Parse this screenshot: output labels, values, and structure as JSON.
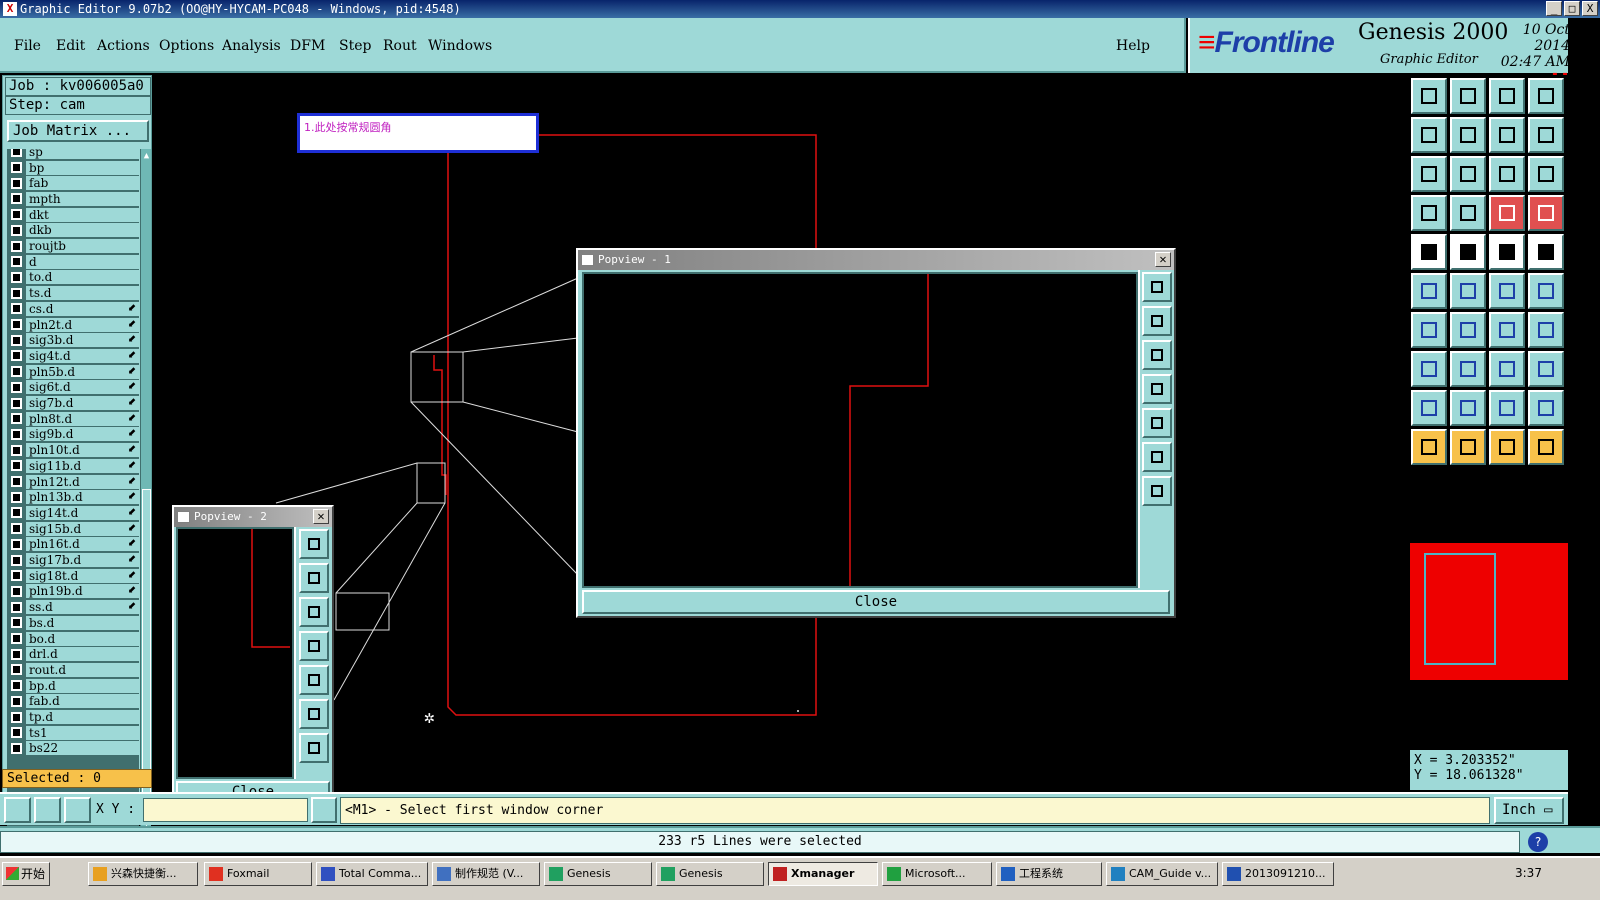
{
  "window": {
    "title": "Graphic Editor 9.07b2 (OO@HY-HYCAM-PC048 - Windows, pid:4548)",
    "controls": [
      "_",
      "□",
      "X"
    ]
  },
  "menu": {
    "items": [
      "File",
      "Edit",
      "Actions",
      "Options",
      "Analysis",
      "DFM",
      "Step",
      "Rout",
      "Windows"
    ],
    "help": "Help"
  },
  "brand": {
    "logo": "Frontline",
    "product": "Genesis 2000",
    "subtitle": "Graphic Editor",
    "date": "10 Oct 2014",
    "time": "02:47 AM"
  },
  "job": {
    "job_label": "Job : kv006005a0",
    "step_label": "Step: cam",
    "matrix_button": "Job Matrix ..."
  },
  "layers": [
    "sp",
    "bp",
    "fab",
    "mpth",
    "dkt",
    "dkb",
    "roujtb",
    "d",
    "to.d",
    "ts.d",
    "cs.d",
    "pln2t.d",
    "sig3b.d",
    "sig4t.d",
    "pln5b.d",
    "sig6t.d",
    "sig7b.d",
    "pln8t.d",
    "sig9b.d",
    "pln10t.d",
    "sig11b.d",
    "pln12t.d",
    "pln13b.d",
    "sig14t.d",
    "sig15b.d",
    "pln16t.d",
    "sig17b.d",
    "sig18t.d",
    "pln19b.d",
    "ss.d",
    "bs.d",
    "bo.d",
    "drl.d",
    "rout.d",
    "bp.d",
    "fab.d",
    "tp.d",
    "ts1",
    "bs22"
  ],
  "layer_flags": [
    "cs.d",
    "pln2t.d",
    "sig3b.d",
    "sig4t.d",
    "pln5b.d",
    "sig6t.d",
    "sig7b.d",
    "pln8t.d",
    "sig9b.d",
    "pln10t.d",
    "sig11b.d",
    "pln12t.d",
    "pln13b.d",
    "sig14t.d",
    "sig15b.d",
    "pln16t.d",
    "sig17b.d",
    "sig18t.d",
    "pln19b.d",
    "ss.d"
  ],
  "selected": "Selected : 0",
  "note": {
    "text": "1.此处按常规圆角"
  },
  "popview1": {
    "title": "Popview - 1",
    "close": "Close"
  },
  "popview2": {
    "title": "Popview - 2",
    "close": "Close"
  },
  "coords": {
    "x": "X = 3.203352\"",
    "y": "Y = 18.061328\""
  },
  "bottombar": {
    "xy_label": "X Y :",
    "message": "<M1> - Select first window corner",
    "unit": "Inch"
  },
  "status": {
    "text": "233 r5 Lines were selected"
  },
  "taskbar": {
    "start": "开始",
    "items": [
      "兴森快捷衡...",
      "Foxmail",
      "Total Comma...",
      "制作规范 (V...",
      "Genesis",
      "Genesis",
      "Xmanager",
      "Microsoft...",
      "工程系统",
      "CAM_Guide v...",
      "2013091210..."
    ],
    "clock": "3:37"
  },
  "colors": {
    "panel": "#9ed9d7",
    "dark_teal": "#406f6e",
    "trace": "#e01010",
    "highlight": "#f7c14a",
    "note_border": "#1e2fd6",
    "note_text": "#c020c0"
  }
}
